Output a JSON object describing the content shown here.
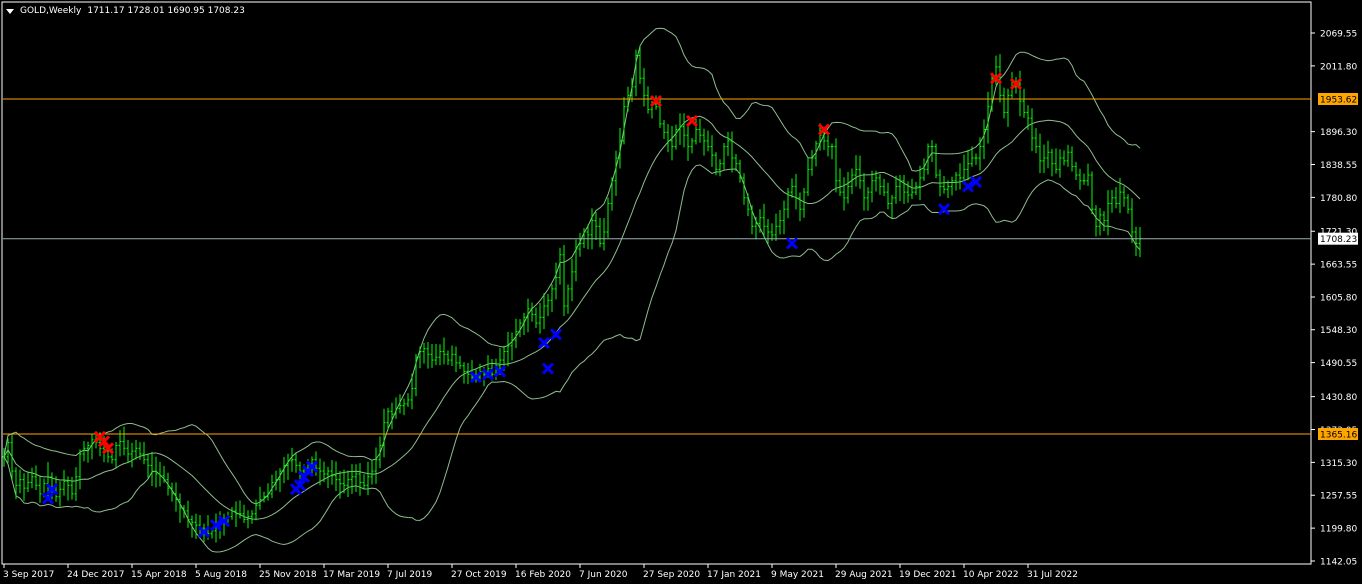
{
  "header": {
    "symbol": "GOLD,Weekly",
    "ohlc": "1711.17 1728.01 1690.95 1708.23"
  },
  "colors": {
    "background": "#000000",
    "frame": "#ffffff",
    "bars": "#00ff00",
    "bands": "#8fbc8f",
    "h_line_orange": "#ffa500",
    "h_line_current": "#9ab0b0",
    "marker_sell": "#ff0000",
    "marker_buy": "#0000ff",
    "price_tag_text": "#000000"
  },
  "chart_data": {
    "type": "bar",
    "title": "GOLD,Weekly",
    "ohlc_last": {
      "open": 1711.17,
      "high": 1728.01,
      "low": 1690.95,
      "close": 1708.23
    },
    "x_tick_labels": [
      "3 Sep 2017",
      "24 Dec 2017",
      "15 Apr 2018",
      "5 Aug 2018",
      "25 Nov 2018",
      "17 Mar 2019",
      "7 Jul 2019",
      "27 Oct 2019",
      "16 Feb 2020",
      "7 Jun 2020",
      "27 Sep 2020",
      "17 Jan 2021",
      "9 May 2021",
      "29 Aug 2021",
      "19 Dec 2021",
      "10 Apr 2022",
      "31 Jul 2022"
    ],
    "y_tick_labels": [
      "2069.55",
      "2011.80",
      "1953.62",
      "1896.30",
      "1838.55",
      "1780.80",
      "1721.30",
      "1708.23",
      "1663.55",
      "1605.80",
      "1548.30",
      "1490.55",
      "1430.80",
      "1373.05",
      "1365.16",
      "1315.30",
      "1257.55",
      "1199.80",
      "1142.05"
    ],
    "y_tick_values": [
      2069.55,
      2011.8,
      1953.62,
      1896.3,
      1838.55,
      1780.8,
      1721.3,
      1708.23,
      1663.55,
      1605.8,
      1548.3,
      1490.55,
      1430.8,
      1373.05,
      1365.16,
      1315.3,
      1257.55,
      1199.8,
      1142.05
    ],
    "ylim": [
      1142.05,
      2069.55
    ],
    "week_start": "3 Sep 2017",
    "price_series_weekly_close": [
      1325,
      1350,
      1300,
      1275,
      1285,
      1270,
      1280,
      1290,
      1275,
      1260,
      1278,
      1290,
      1265,
      1255,
      1268,
      1282,
      1275,
      1260,
      1290,
      1330,
      1340,
      1345,
      1355,
      1350,
      1340,
      1335,
      1325,
      1320,
      1345,
      1352,
      1340,
      1330,
      1335,
      1340,
      1330,
      1320,
      1310,
      1300,
      1295,
      1292,
      1285,
      1270,
      1260,
      1250,
      1235,
      1230,
      1215,
      1210,
      1205,
      1200,
      1198,
      1190,
      1195,
      1205,
      1210,
      1215,
      1220,
      1230,
      1225,
      1225,
      1215,
      1220,
      1225,
      1240,
      1250,
      1255,
      1260,
      1280,
      1285,
      1300,
      1310,
      1318,
      1320,
      1310,
      1300,
      1305,
      1312,
      1320,
      1305,
      1300,
      1295,
      1300,
      1292,
      1285,
      1278,
      1275,
      1285,
      1290,
      1295,
      1280,
      1275,
      1290,
      1300,
      1320,
      1345,
      1385,
      1405,
      1400,
      1410,
      1415,
      1418,
      1425,
      1445,
      1500,
      1510,
      1515,
      1505,
      1495,
      1500,
      1510,
      1505,
      1495,
      1505,
      1490,
      1485,
      1475,
      1470,
      1465,
      1465,
      1475,
      1470,
      1480,
      1470,
      1485,
      1495,
      1510,
      1520,
      1530,
      1545,
      1560,
      1570,
      1585,
      1575,
      1560,
      1570,
      1590,
      1600,
      1620,
      1640,
      1680,
      1590,
      1620,
      1650,
      1690,
      1700,
      1720,
      1715,
      1740,
      1730,
      1700,
      1720,
      1770,
      1810,
      1850,
      1880,
      1940,
      1960,
      1975,
      2030,
      1990,
      1960,
      1935,
      1945,
      1940,
      1910,
      1895,
      1880,
      1870,
      1900,
      1905,
      1890,
      1870,
      1880,
      1900,
      1890,
      1880,
      1870,
      1855,
      1830,
      1840,
      1870,
      1880,
      1850,
      1840,
      1815,
      1780,
      1760,
      1730,
      1735,
      1745,
      1730,
      1720,
      1715,
      1730,
      1740,
      1760,
      1790,
      1800,
      1780,
      1760,
      1790,
      1830,
      1850,
      1875,
      1890,
      1880,
      1870,
      1870,
      1810,
      1790,
      1780,
      1800,
      1820,
      1830,
      1810,
      1780,
      1790,
      1810,
      1815,
      1800,
      1790,
      1770,
      1780,
      1800,
      1810,
      1790,
      1785,
      1790,
      1800,
      1815,
      1830,
      1870,
      1870,
      1820,
      1800,
      1795,
      1800,
      1810,
      1820,
      1815,
      1830,
      1840,
      1850,
      1850,
      1870,
      1900,
      1940,
      1990,
      2010,
      1960,
      1930,
      1960,
      1975,
      1980,
      1950,
      1930,
      1920,
      1885,
      1870,
      1845,
      1850,
      1860,
      1840,
      1830,
      1850,
      1845,
      1860,
      1835,
      1820,
      1810,
      1810,
      1820,
      1760,
      1730,
      1750,
      1740,
      1770,
      1780,
      1770,
      1790,
      1780,
      1760,
      1720,
      1700,
      1708
    ],
    "series": [],
    "horizontal_levels": [
      {
        "value": 1953.62,
        "label": "1953.62",
        "style": "orange"
      },
      {
        "value": 1708.23,
        "label": "1708.23",
        "style": "current"
      },
      {
        "value": 1365.16,
        "label": "1365.16",
        "style": "orange"
      }
    ],
    "sell_markers": [
      {
        "week": 24,
        "price": 1360
      },
      {
        "week": 25,
        "price": 1352
      },
      {
        "week": 26,
        "price": 1340
      },
      {
        "week": 163,
        "price": 1950
      },
      {
        "week": 172,
        "price": 1915
      },
      {
        "week": 205,
        "price": 1900
      },
      {
        "week": 248,
        "price": 1990
      },
      {
        "week": 253,
        "price": 1980
      }
    ],
    "buy_markers": [
      {
        "week": 11,
        "price": 1252
      },
      {
        "week": 12,
        "price": 1268
      },
      {
        "week": 50,
        "price": 1193
      },
      {
        "week": 53,
        "price": 1205
      },
      {
        "week": 55,
        "price": 1212
      },
      {
        "week": 73,
        "price": 1268
      },
      {
        "week": 74,
        "price": 1275
      },
      {
        "week": 75,
        "price": 1290
      },
      {
        "week": 76,
        "price": 1300
      },
      {
        "week": 77,
        "price": 1308
      },
      {
        "week": 118,
        "price": 1465
      },
      {
        "week": 121,
        "price": 1470
      },
      {
        "week": 124,
        "price": 1475
      },
      {
        "week": 135,
        "price": 1525
      },
      {
        "week": 136,
        "price": 1480
      },
      {
        "week": 138,
        "price": 1540
      },
      {
        "week": 197,
        "price": 1700
      },
      {
        "week": 235,
        "price": 1760
      },
      {
        "week": 241,
        "price": 1800
      },
      {
        "week": 243,
        "price": 1808
      }
    ]
  }
}
